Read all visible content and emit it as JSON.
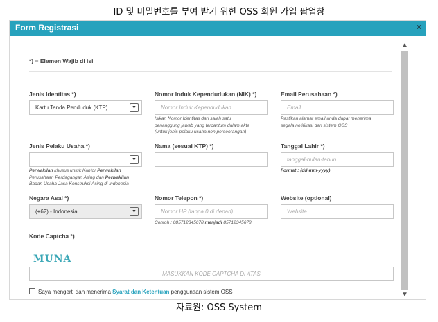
{
  "caption_top": "ID 및 비밀번호를 부여 받기 위한 OSS 회원 가입 팝업창",
  "caption_bottom": "자료원: OSS System",
  "modal": {
    "title": "Form Registrasi",
    "close_icon": "×",
    "required_note": "*) = Elemen Wajib di isi"
  },
  "form": {
    "jenis_identitas": {
      "label": "Jenis Identitas *)",
      "value": "Kartu Tanda Penduduk (KTP)"
    },
    "nik": {
      "label": "Nomor Induk Kependudukan (NIK) *)",
      "placeholder": "Nomor Induk Kependudukan",
      "help": [
        "Isikan Nomor Identitas dari salah satu",
        "penanggung jawab yang tercantum dalam akta",
        "(untuk jenis pelaku usaha non perseorangan)"
      ]
    },
    "email": {
      "label": "Email Perusahaan *)",
      "placeholder": "Email",
      "help": [
        "Pastikan alamat email anda dapat menerima",
        "segala notifikasi dari sistem OSS"
      ]
    },
    "jenis_pelaku": {
      "label": "Jenis Pelaku Usaha *)",
      "value": "",
      "help_line1_bold": "Perwakilan",
      "help_line1_rest": " khusus untuk Kantor ",
      "help_line1_bold2": "Perwakilan",
      "help_line2_rest": "Perusahaan Perdagangan Asing dan ",
      "help_line2_bold": "Perwakilan",
      "help_line3": "Badan Usaha Jasa Konstruksi Asing di Indonesia"
    },
    "nama": {
      "label": "Nama (sesuai KTP) *)",
      "value": ""
    },
    "tanggal_lahir": {
      "label": "Tanggal Lahir *)",
      "placeholder": "tanggal-bulan-tahun",
      "help": "Format : (dd-mm-yyyy)"
    },
    "negara_asal": {
      "label": "Negara Asal *)",
      "value": "(+62) - Indonesia"
    },
    "telepon": {
      "label": "Nomor Telepon *)",
      "placeholder": "Nomor HP (tanpa 0 di depan)",
      "help_prefix": "Contoh : 085712345678 ",
      "help_bold": "menjadi",
      "help_suffix": " 85712345678"
    },
    "website": {
      "label": "Website (optional)",
      "placeholder": "Website"
    },
    "captcha": {
      "label": "Kode Captcha *)",
      "image_text": "MUNA",
      "placeholder": "MASUKKAN KODE CAPTCHA DI ATAS"
    },
    "terms": {
      "prefix": "Saya mengerti dan menerima ",
      "link": "Syarat dan Ketentuan",
      "suffix": " penggunaan sistem OSS"
    },
    "select_arrow": "▼"
  },
  "scroll": {
    "up": "▲",
    "down": "▼"
  },
  "colors": {
    "header": "#27a2bd",
    "link": "#27a2bd"
  }
}
